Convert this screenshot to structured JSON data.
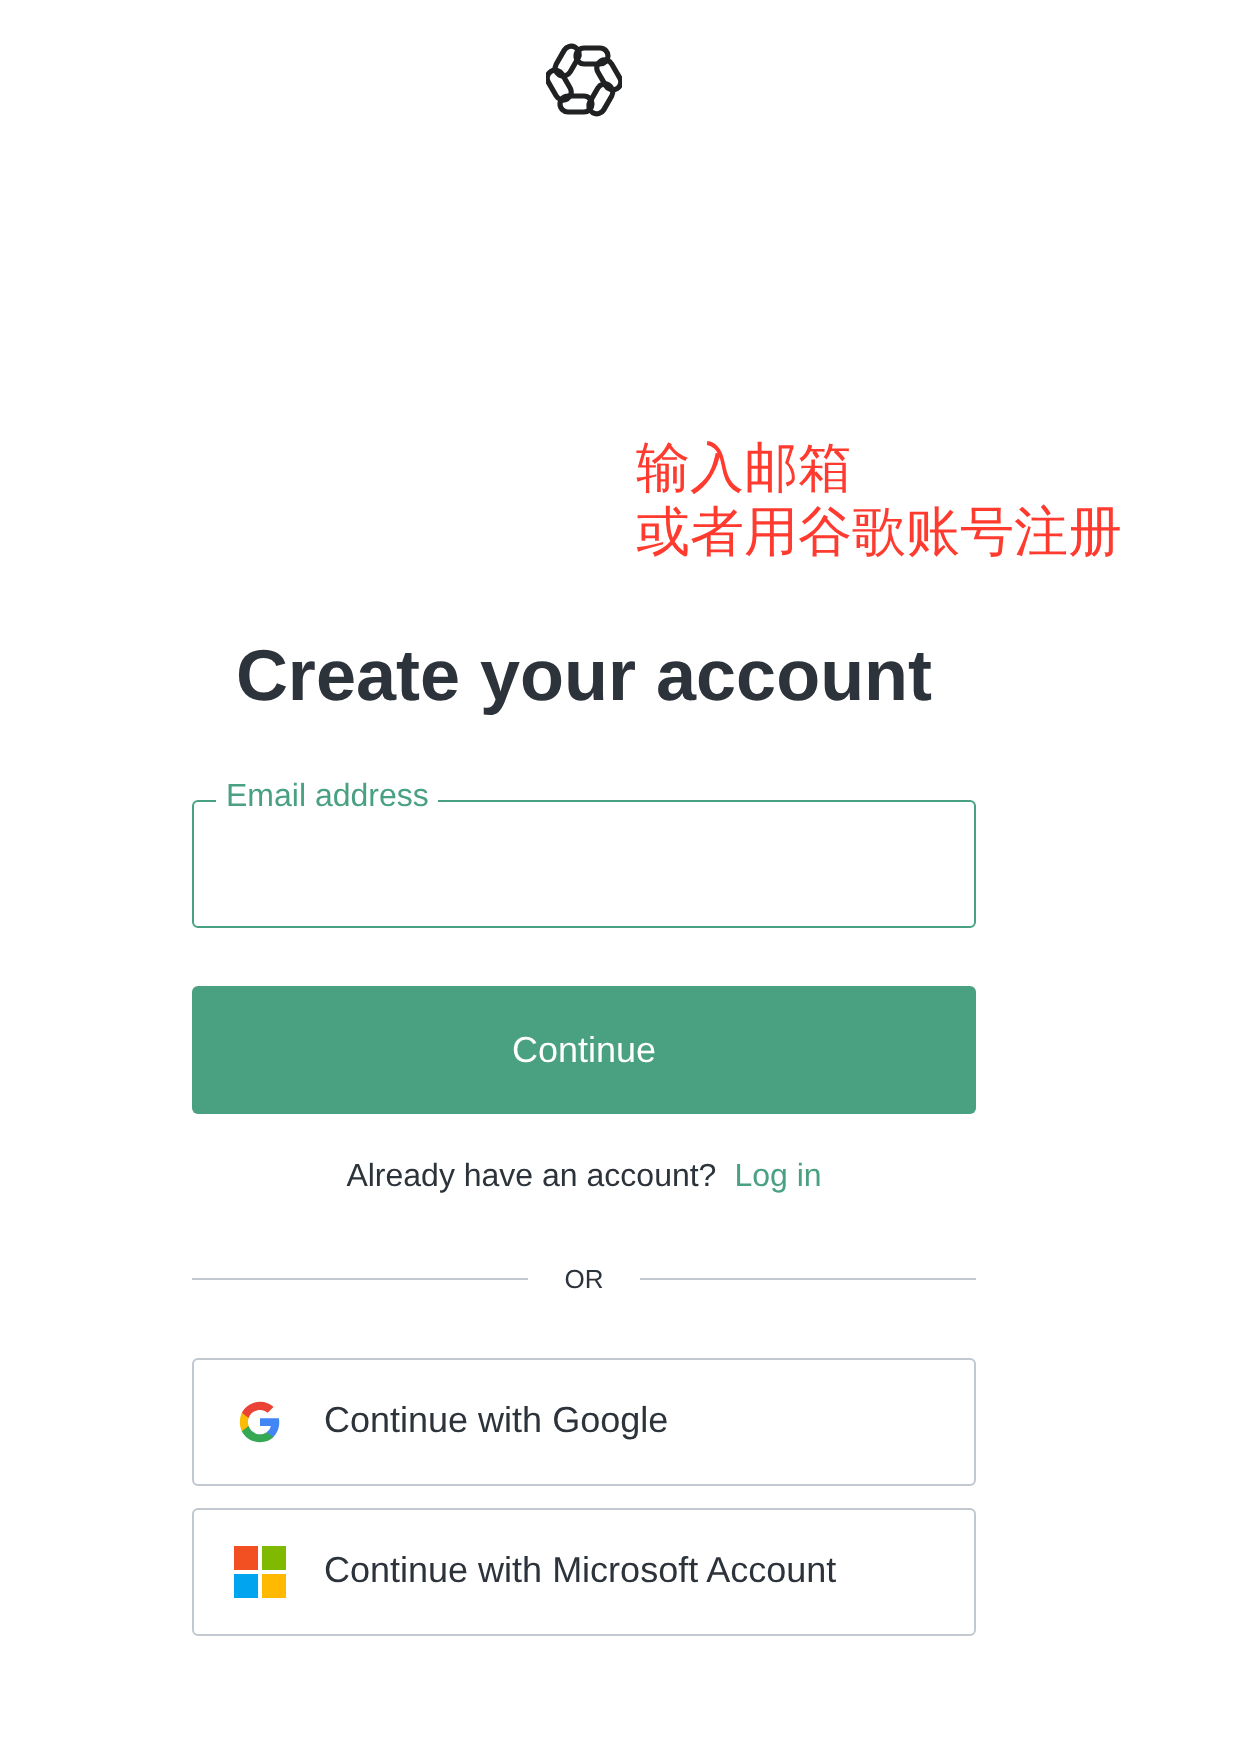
{
  "annotation": [
    "输入邮箱",
    "或者用谷歌账号注册"
  ],
  "heading": "Create your account",
  "email_field": {
    "label": "Email address"
  },
  "continue_button": "Continue",
  "login_prompt": {
    "text": "Already have an account?",
    "link": "Log in"
  },
  "divider": "OR",
  "providers": [
    {
      "kind": "google",
      "label": "Continue with Google"
    },
    {
      "kind": "microsoft",
      "label": "Continue with Microsoft Account"
    }
  ]
}
